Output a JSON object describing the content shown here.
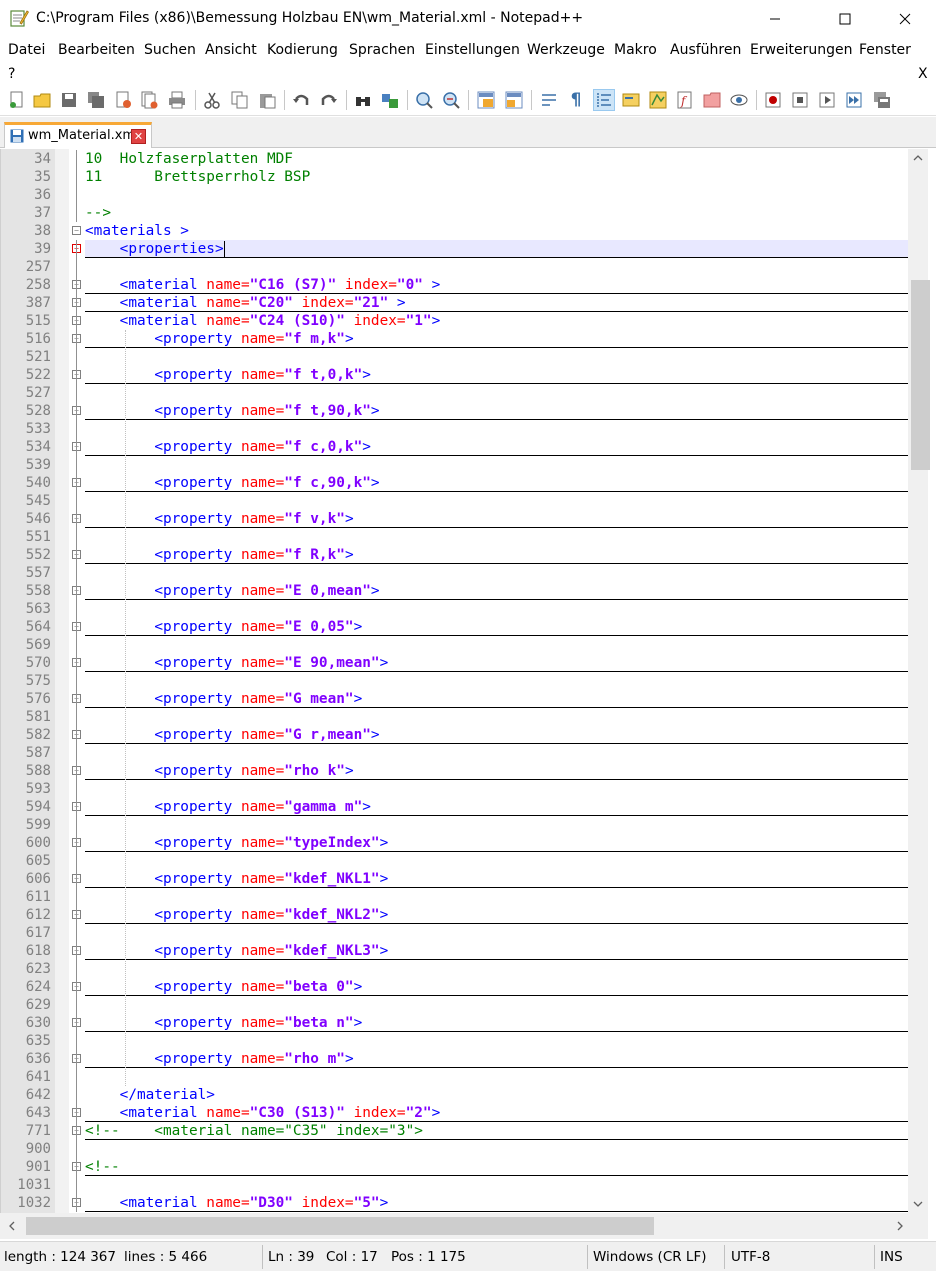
{
  "window": {
    "title": "C:\\Program Files (x86)\\Bemessung Holzbau EN\\wm_Material.xml - Notepad++",
    "minimize_glyph": "—",
    "maximize_glyph": "☐",
    "close_glyph": "✕"
  },
  "menu": {
    "items": [
      "Datei",
      "Bearbeiten",
      "Suchen",
      "Ansicht",
      "Kodierung",
      "Sprachen",
      "Einstellungen",
      "Werkzeuge",
      "Makro",
      "Ausführen",
      "Erweiterungen",
      "Fenster"
    ],
    "help": "?",
    "close_doc": "X"
  },
  "toolbar": {
    "icons": [
      "new-file-icon",
      "open-file-icon",
      "save-icon",
      "save-all-icon",
      "close-icon",
      "close-all-icon",
      "print-icon",
      "cut-icon",
      "copy-icon",
      "paste-icon",
      "undo-icon",
      "redo-icon",
      "find-icon",
      "replace-icon",
      "zoom-in-icon",
      "zoom-out-icon",
      "sync-vertical-icon",
      "sync-horizontal-icon",
      "word-wrap-icon",
      "show-all-chars-icon",
      "indent-guide-icon",
      "language-icon",
      "doc-map-icon",
      "function-list-icon",
      "folder-workspace-icon",
      "monitor-icon",
      "record-macro-icon",
      "stop-record-icon",
      "play-macro-icon",
      "run-macro-multiple-icon",
      "save-macro-icon"
    ]
  },
  "tab": {
    "label": "wm_Material.xml",
    "close_glyph": "✕"
  },
  "editor": {
    "lines": [
      {
        "n": "34",
        "segs": [
          {
            "c": "cmt",
            "t": "10  Holzfaserplatten MDF"
          }
        ]
      },
      {
        "n": "35",
        "segs": [
          {
            "c": "cmt",
            "t": "11      Brettsperrholz BSP"
          }
        ]
      },
      {
        "n": "36",
        "segs": []
      },
      {
        "n": "37",
        "segs": [
          {
            "c": "cmt",
            "t": "-->"
          }
        ]
      },
      {
        "n": "38",
        "segs": [
          {
            "c": "tag",
            "t": "<materials >"
          }
        ]
      },
      {
        "n": "39",
        "segs": [
          {
            "c": "txt",
            "t": "    "
          },
          {
            "c": "tag",
            "t": "<properties>"
          }
        ]
      },
      {
        "n": "257",
        "segs": []
      },
      {
        "n": "258",
        "segs": [
          {
            "c": "txt",
            "t": "    "
          },
          {
            "c": "tag",
            "t": "<material "
          },
          {
            "c": "attr",
            "t": "name="
          },
          {
            "c": "val",
            "t": "\"C16 (S7)\""
          },
          {
            "c": "attr",
            "t": " index="
          },
          {
            "c": "val",
            "t": "\"0\""
          },
          {
            "c": "tag",
            "t": " >"
          }
        ]
      },
      {
        "n": "387",
        "segs": [
          {
            "c": "txt",
            "t": "    "
          },
          {
            "c": "tag",
            "t": "<material "
          },
          {
            "c": "attr",
            "t": "name="
          },
          {
            "c": "val",
            "t": "\"C20\""
          },
          {
            "c": "attr",
            "t": " index="
          },
          {
            "c": "val",
            "t": "\"21\""
          },
          {
            "c": "tag",
            "t": " >"
          }
        ]
      },
      {
        "n": "515",
        "segs": [
          {
            "c": "txt",
            "t": "    "
          },
          {
            "c": "tag",
            "t": "<material "
          },
          {
            "c": "attr",
            "t": "name="
          },
          {
            "c": "val",
            "t": "\"C24 (S10)\""
          },
          {
            "c": "attr",
            "t": " index="
          },
          {
            "c": "val",
            "t": "\"1\""
          },
          {
            "c": "tag",
            "t": ">"
          }
        ]
      },
      {
        "n": "516",
        "segs": [
          {
            "c": "txt",
            "t": "        "
          },
          {
            "c": "tag",
            "t": "<property "
          },
          {
            "c": "attr",
            "t": "name="
          },
          {
            "c": "val",
            "t": "\"f m,k\""
          },
          {
            "c": "tag",
            "t": ">"
          }
        ]
      },
      {
        "n": "521",
        "segs": []
      },
      {
        "n": "522",
        "segs": [
          {
            "c": "txt",
            "t": "        "
          },
          {
            "c": "tag",
            "t": "<property "
          },
          {
            "c": "attr",
            "t": "name="
          },
          {
            "c": "val",
            "t": "\"f t,0,k\""
          },
          {
            "c": "tag",
            "t": ">"
          }
        ]
      },
      {
        "n": "527",
        "segs": []
      },
      {
        "n": "528",
        "segs": [
          {
            "c": "txt",
            "t": "        "
          },
          {
            "c": "tag",
            "t": "<property "
          },
          {
            "c": "attr",
            "t": "name="
          },
          {
            "c": "val",
            "t": "\"f t,90,k\""
          },
          {
            "c": "tag",
            "t": ">"
          }
        ]
      },
      {
        "n": "533",
        "segs": []
      },
      {
        "n": "534",
        "segs": [
          {
            "c": "txt",
            "t": "        "
          },
          {
            "c": "tag",
            "t": "<property "
          },
          {
            "c": "attr",
            "t": "name="
          },
          {
            "c": "val",
            "t": "\"f c,0,k\""
          },
          {
            "c": "tag",
            "t": ">"
          }
        ]
      },
      {
        "n": "539",
        "segs": []
      },
      {
        "n": "540",
        "segs": [
          {
            "c": "txt",
            "t": "        "
          },
          {
            "c": "tag",
            "t": "<property "
          },
          {
            "c": "attr",
            "t": "name="
          },
          {
            "c": "val",
            "t": "\"f c,90,k\""
          },
          {
            "c": "tag",
            "t": ">"
          }
        ]
      },
      {
        "n": "545",
        "segs": []
      },
      {
        "n": "546",
        "segs": [
          {
            "c": "txt",
            "t": "        "
          },
          {
            "c": "tag",
            "t": "<property "
          },
          {
            "c": "attr",
            "t": "name="
          },
          {
            "c": "val",
            "t": "\"f v,k\""
          },
          {
            "c": "tag",
            "t": ">"
          }
        ]
      },
      {
        "n": "551",
        "segs": []
      },
      {
        "n": "552",
        "segs": [
          {
            "c": "txt",
            "t": "        "
          },
          {
            "c": "tag",
            "t": "<property "
          },
          {
            "c": "attr",
            "t": "name="
          },
          {
            "c": "val",
            "t": "\"f R,k\""
          },
          {
            "c": "tag",
            "t": ">"
          }
        ]
      },
      {
        "n": "557",
        "segs": []
      },
      {
        "n": "558",
        "segs": [
          {
            "c": "txt",
            "t": "        "
          },
          {
            "c": "tag",
            "t": "<property "
          },
          {
            "c": "attr",
            "t": "name="
          },
          {
            "c": "val",
            "t": "\"E 0,mean\""
          },
          {
            "c": "tag",
            "t": ">"
          }
        ]
      },
      {
        "n": "563",
        "segs": []
      },
      {
        "n": "564",
        "segs": [
          {
            "c": "txt",
            "t": "        "
          },
          {
            "c": "tag",
            "t": "<property "
          },
          {
            "c": "attr",
            "t": "name="
          },
          {
            "c": "val",
            "t": "\"E 0,05\""
          },
          {
            "c": "tag",
            "t": ">"
          }
        ]
      },
      {
        "n": "569",
        "segs": []
      },
      {
        "n": "570",
        "segs": [
          {
            "c": "txt",
            "t": "        "
          },
          {
            "c": "tag",
            "t": "<property "
          },
          {
            "c": "attr",
            "t": "name="
          },
          {
            "c": "val",
            "t": "\"E 90,mean\""
          },
          {
            "c": "tag",
            "t": ">"
          }
        ]
      },
      {
        "n": "575",
        "segs": []
      },
      {
        "n": "576",
        "segs": [
          {
            "c": "txt",
            "t": "        "
          },
          {
            "c": "tag",
            "t": "<property "
          },
          {
            "c": "attr",
            "t": "name="
          },
          {
            "c": "val",
            "t": "\"G mean\""
          },
          {
            "c": "tag",
            "t": ">"
          }
        ]
      },
      {
        "n": "581",
        "segs": []
      },
      {
        "n": "582",
        "segs": [
          {
            "c": "txt",
            "t": "        "
          },
          {
            "c": "tag",
            "t": "<property "
          },
          {
            "c": "attr",
            "t": "name="
          },
          {
            "c": "val",
            "t": "\"G r,mean\""
          },
          {
            "c": "tag",
            "t": ">"
          }
        ]
      },
      {
        "n": "587",
        "segs": []
      },
      {
        "n": "588",
        "segs": [
          {
            "c": "txt",
            "t": "        "
          },
          {
            "c": "tag",
            "t": "<property "
          },
          {
            "c": "attr",
            "t": "name="
          },
          {
            "c": "val",
            "t": "\"rho k\""
          },
          {
            "c": "tag",
            "t": ">"
          }
        ]
      },
      {
        "n": "593",
        "segs": []
      },
      {
        "n": "594",
        "segs": [
          {
            "c": "txt",
            "t": "        "
          },
          {
            "c": "tag",
            "t": "<property "
          },
          {
            "c": "attr",
            "t": "name="
          },
          {
            "c": "val",
            "t": "\"gamma m\""
          },
          {
            "c": "tag",
            "t": ">"
          }
        ]
      },
      {
        "n": "599",
        "segs": []
      },
      {
        "n": "600",
        "segs": [
          {
            "c": "txt",
            "t": "        "
          },
          {
            "c": "tag",
            "t": "<property "
          },
          {
            "c": "attr",
            "t": "name="
          },
          {
            "c": "val",
            "t": "\"typeIndex\""
          },
          {
            "c": "tag",
            "t": ">"
          }
        ]
      },
      {
        "n": "605",
        "segs": []
      },
      {
        "n": "606",
        "segs": [
          {
            "c": "txt",
            "t": "        "
          },
          {
            "c": "tag",
            "t": "<property "
          },
          {
            "c": "attr",
            "t": "name="
          },
          {
            "c": "val",
            "t": "\"kdef_NKL1\""
          },
          {
            "c": "tag",
            "t": ">"
          }
        ]
      },
      {
        "n": "611",
        "segs": []
      },
      {
        "n": "612",
        "segs": [
          {
            "c": "txt",
            "t": "        "
          },
          {
            "c": "tag",
            "t": "<property "
          },
          {
            "c": "attr",
            "t": "name="
          },
          {
            "c": "val",
            "t": "\"kdef_NKL2\""
          },
          {
            "c": "tag",
            "t": ">"
          }
        ]
      },
      {
        "n": "617",
        "segs": []
      },
      {
        "n": "618",
        "segs": [
          {
            "c": "txt",
            "t": "        "
          },
          {
            "c": "tag",
            "t": "<property "
          },
          {
            "c": "attr",
            "t": "name="
          },
          {
            "c": "val",
            "t": "\"kdef_NKL3\""
          },
          {
            "c": "tag",
            "t": ">"
          }
        ]
      },
      {
        "n": "623",
        "segs": []
      },
      {
        "n": "624",
        "segs": [
          {
            "c": "txt",
            "t": "        "
          },
          {
            "c": "tag",
            "t": "<property "
          },
          {
            "c": "attr",
            "t": "name="
          },
          {
            "c": "val",
            "t": "\"beta 0\""
          },
          {
            "c": "tag",
            "t": ">"
          }
        ]
      },
      {
        "n": "629",
        "segs": []
      },
      {
        "n": "630",
        "segs": [
          {
            "c": "txt",
            "t": "        "
          },
          {
            "c": "tag",
            "t": "<property "
          },
          {
            "c": "attr",
            "t": "name="
          },
          {
            "c": "val",
            "t": "\"beta n\""
          },
          {
            "c": "tag",
            "t": ">"
          }
        ]
      },
      {
        "n": "635",
        "segs": []
      },
      {
        "n": "636",
        "segs": [
          {
            "c": "txt",
            "t": "        "
          },
          {
            "c": "tag",
            "t": "<property "
          },
          {
            "c": "attr",
            "t": "name="
          },
          {
            "c": "val",
            "t": "\"rho m\""
          },
          {
            "c": "tag",
            "t": ">"
          }
        ]
      },
      {
        "n": "641",
        "segs": []
      },
      {
        "n": "642",
        "segs": [
          {
            "c": "txt",
            "t": "    "
          },
          {
            "c": "tag",
            "t": "</material>"
          }
        ]
      },
      {
        "n": "643",
        "segs": [
          {
            "c": "txt",
            "t": "    "
          },
          {
            "c": "tag",
            "t": "<material "
          },
          {
            "c": "attr",
            "t": "name="
          },
          {
            "c": "val",
            "t": "\"C30 (S13)\""
          },
          {
            "c": "attr",
            "t": " index="
          },
          {
            "c": "val",
            "t": "\"2\""
          },
          {
            "c": "tag",
            "t": ">"
          }
        ]
      },
      {
        "n": "771",
        "segs": [
          {
            "c": "cmt",
            "t": "<!--    <material name=\"C35\" index=\"3\">"
          }
        ]
      },
      {
        "n": "900",
        "segs": []
      },
      {
        "n": "901",
        "segs": [
          {
            "c": "cmt",
            "t": "<!--"
          }
        ]
      },
      {
        "n": "1031",
        "segs": []
      },
      {
        "n": "1032",
        "segs": [
          {
            "c": "txt",
            "t": "    "
          },
          {
            "c": "tag",
            "t": "<material "
          },
          {
            "c": "attr",
            "t": "name="
          },
          {
            "c": "val",
            "t": "\"D30\""
          },
          {
            "c": "attr",
            "t": " index="
          },
          {
            "c": "val",
            "t": "\"5\""
          },
          {
            "c": "tag",
            "t": ">"
          }
        ]
      }
    ]
  },
  "status": {
    "length": "length : 124 367",
    "lines": "lines : 5 466",
    "ln": "Ln : 39",
    "col": "Col : 17",
    "pos": "Pos : 1 175",
    "eol": "Windows (CR LF)",
    "encoding": "UTF-8",
    "mode": "INS"
  },
  "colors": {
    "tag": "#0000ff",
    "attr": "#ff0000",
    "value": "#8000ff",
    "comment": "#008000",
    "tab_accent": "#f7a836"
  }
}
